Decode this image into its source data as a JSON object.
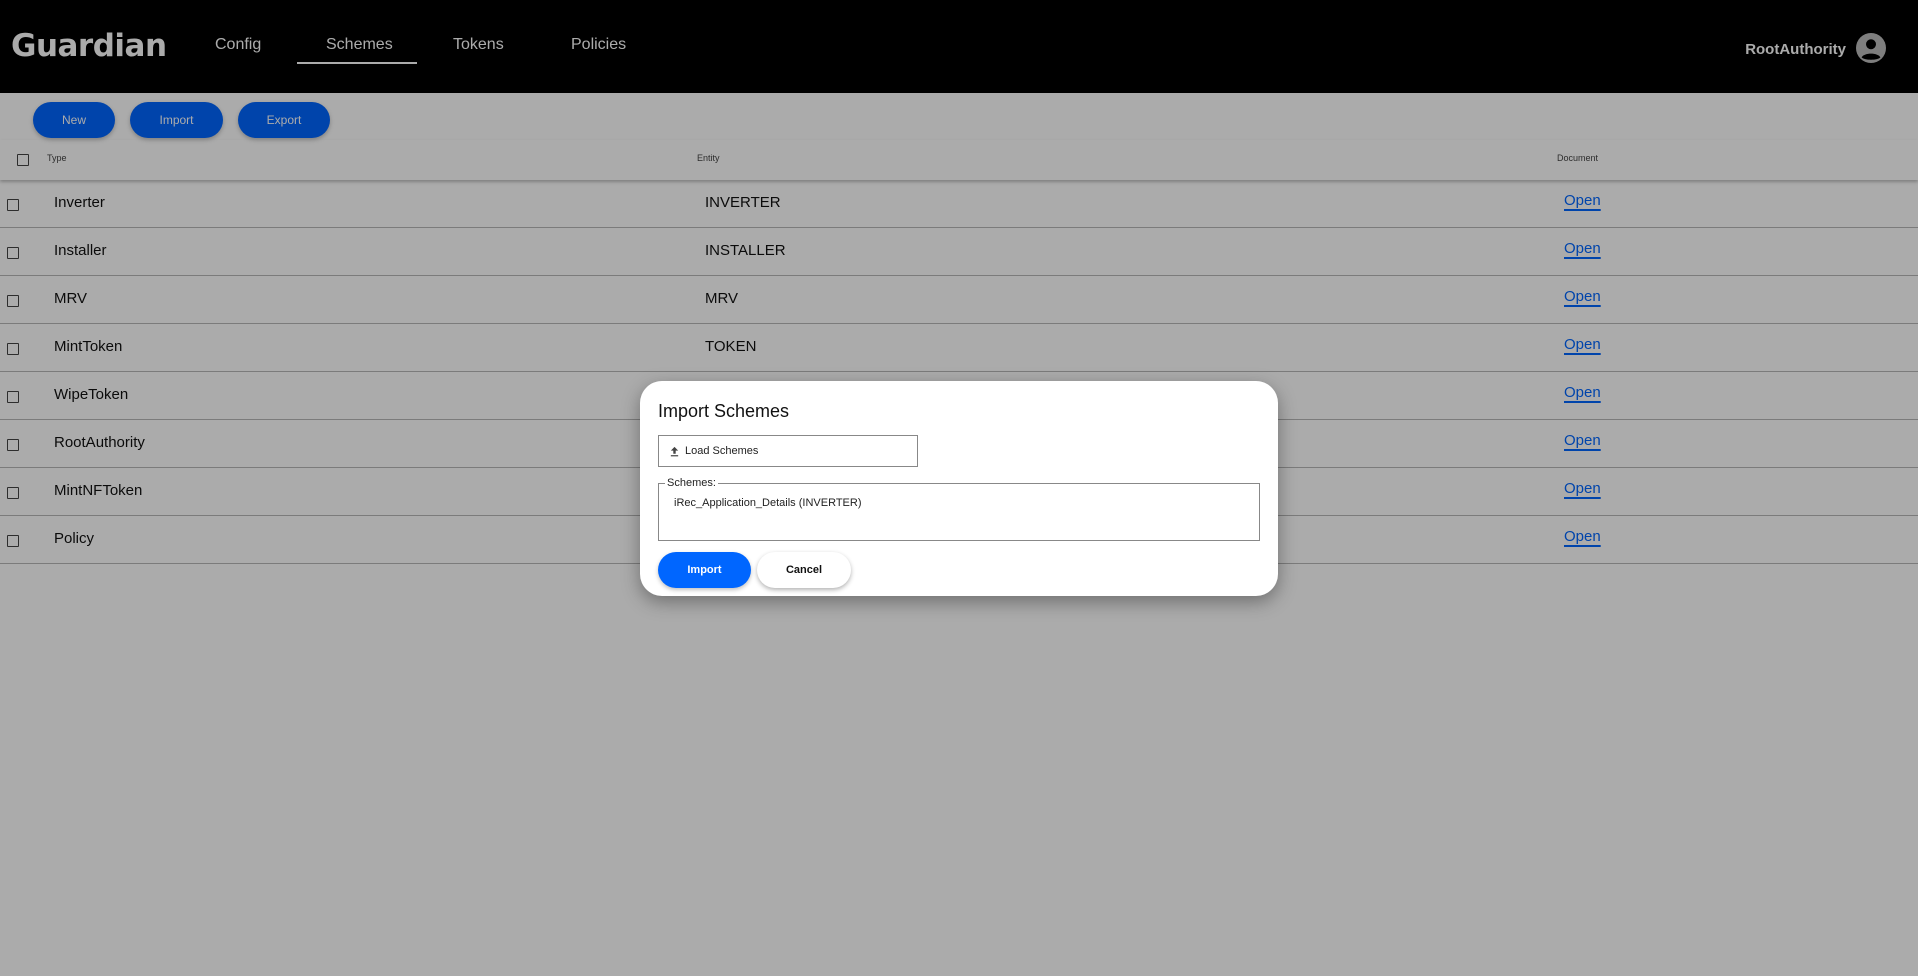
{
  "header": {
    "logo": "Guardian",
    "nav": [
      {
        "label": "Config"
      },
      {
        "label": "Schemes",
        "active": true
      },
      {
        "label": "Tokens"
      },
      {
        "label": "Policies"
      }
    ],
    "user": {
      "name": "RootAuthority",
      "icon": "account-circle-icon"
    }
  },
  "toolbar": {
    "new_label": "New",
    "import_label": "Import",
    "export_label": "Export"
  },
  "table": {
    "columns": [
      "Type",
      "Entity",
      "Document"
    ],
    "rows": [
      {
        "type": "Inverter",
        "entity": "INVERTER",
        "document": "Open"
      },
      {
        "type": "Installer",
        "entity": "INSTALLER",
        "document": "Open"
      },
      {
        "type": "MRV",
        "entity": "MRV",
        "document": "Open"
      },
      {
        "type": "MintToken",
        "entity": "TOKEN",
        "document": "Open"
      },
      {
        "type": "WipeToken",
        "entity": "",
        "document": "Open"
      },
      {
        "type": "RootAuthority",
        "entity": "",
        "document": "Open"
      },
      {
        "type": "MintNFToken",
        "entity": "",
        "document": "Open"
      },
      {
        "type": "Policy",
        "entity": "",
        "document": "Open"
      }
    ]
  },
  "dialog": {
    "title": "Import Schemes",
    "load_label": "Load Schemes",
    "schemes_legend": "Schemes:",
    "schemes": [
      "iRec_Application_Details (INVERTER)"
    ],
    "import_label": "Import",
    "cancel_label": "Cancel"
  },
  "colors": {
    "accent": "#0066ff",
    "header_bg": "#000000",
    "overlay": "rgba(0,0,0,0.33)"
  }
}
